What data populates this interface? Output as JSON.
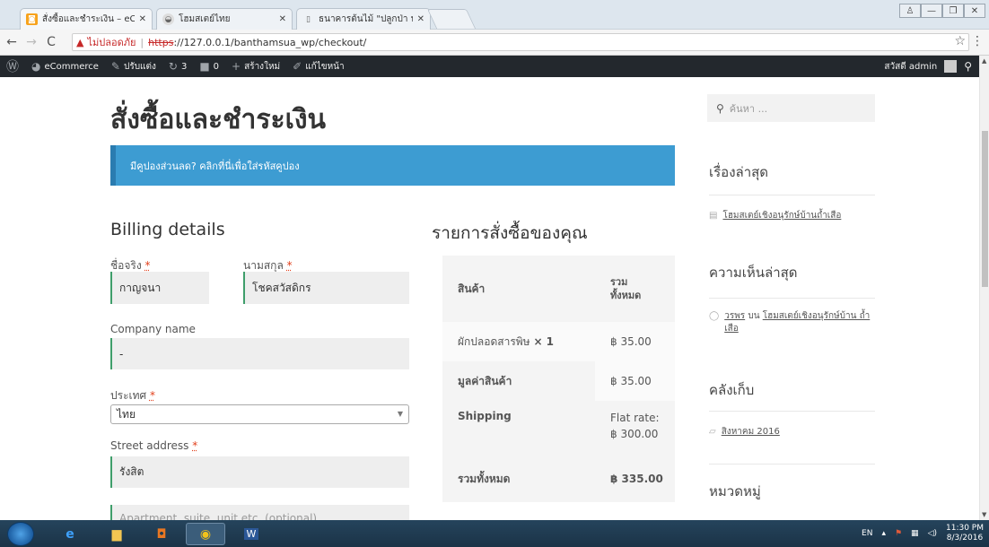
{
  "browser": {
    "tabs": [
      {
        "title": "สั่งซื้อและชำระเงิน – eComm",
        "active": true,
        "favicon": "woo-icon"
      },
      {
        "title": "โฮมสเตย์ไทย",
        "active": false,
        "favicon": "globe-icon"
      },
      {
        "title": "ธนาคารต้นไม้ \"ปลูกป่า ปลูก",
        "active": false,
        "favicon": "page-icon"
      }
    ],
    "not_secure": "ไม่ปลอดภัย",
    "url_scheme": "https",
    "url_rest": "://127.0.0.1/banthamsua_wp/checkout/"
  },
  "adminbar": {
    "site": "eCommerce",
    "customize": "ปรับแต่ง",
    "updates": "3",
    "comments": "0",
    "new": "สร้างใหม่",
    "edit": "แก้ไขหน้า",
    "greeting": "สวัสดี admin"
  },
  "page": {
    "title": "สั่งซื้อและชำระเงิน",
    "coupon_text": "มีคูปองส่วนลด? คลิกที่นี่เพื่อใส่รหัสคูปอง"
  },
  "billing": {
    "heading": "Billing details",
    "first_name_label": "ชื่อจริง",
    "first_name_value": "กาญจนา",
    "last_name_label": "นามสกุล",
    "last_name_value": "โชคสวัสดิกร",
    "company_label": "Company name",
    "company_value": "-",
    "country_label": "ประเทศ",
    "country_value": "ไทย",
    "street_label": "Street address",
    "street_value": "รังสิต",
    "apartment_placeholder": "Apartment, suite, unit etc. (optional)",
    "required_mark": "*"
  },
  "order": {
    "heading": "รายการสั่งซื้อของคุณ",
    "col_product": "สินค้า",
    "col_total_1": "รวม",
    "col_total_2": "ทั้งหมด",
    "item_name": "ผักปลอดสารพิษ",
    "item_qty": "× 1",
    "item_total": "฿ 35.00",
    "subtotal_label": "มูลค่าสินค้า",
    "subtotal_value": "฿ 35.00",
    "shipping_label": "Shipping",
    "shipping_value_1": "Flat rate:",
    "shipping_value_2": "฿ 300.00",
    "total_label": "รวมทั้งหมด",
    "total_value": "฿ 335.00"
  },
  "sidebar": {
    "search_placeholder": "ค้นหา ...",
    "recent_posts_heading": "เรื่องล่าสุด",
    "recent_post_1": "โฮมสเตย์เชิงอนุรักษ์บ้านถ้ำเสือ",
    "recent_comments_heading": "ความเห็นล่าสุด",
    "comment_author": "วรพร",
    "comment_on": "บน",
    "comment_post": "โฮมสเตย์เชิงอนุรักษ์บ้าน ถ้ำเสือ",
    "archives_heading": "คลังเก็บ",
    "archive_1": "สิงหาคม 2016",
    "categories_heading": "หมวดหมู่"
  },
  "taskbar": {
    "lang": "EN",
    "time": "11:30 PM",
    "date": "8/3/2016"
  },
  "colors": {
    "coupon_bg": "#3d9cd2",
    "adminbar_bg": "#23282d",
    "input_accent": "#3f9e6b",
    "required": "#e2401c"
  }
}
